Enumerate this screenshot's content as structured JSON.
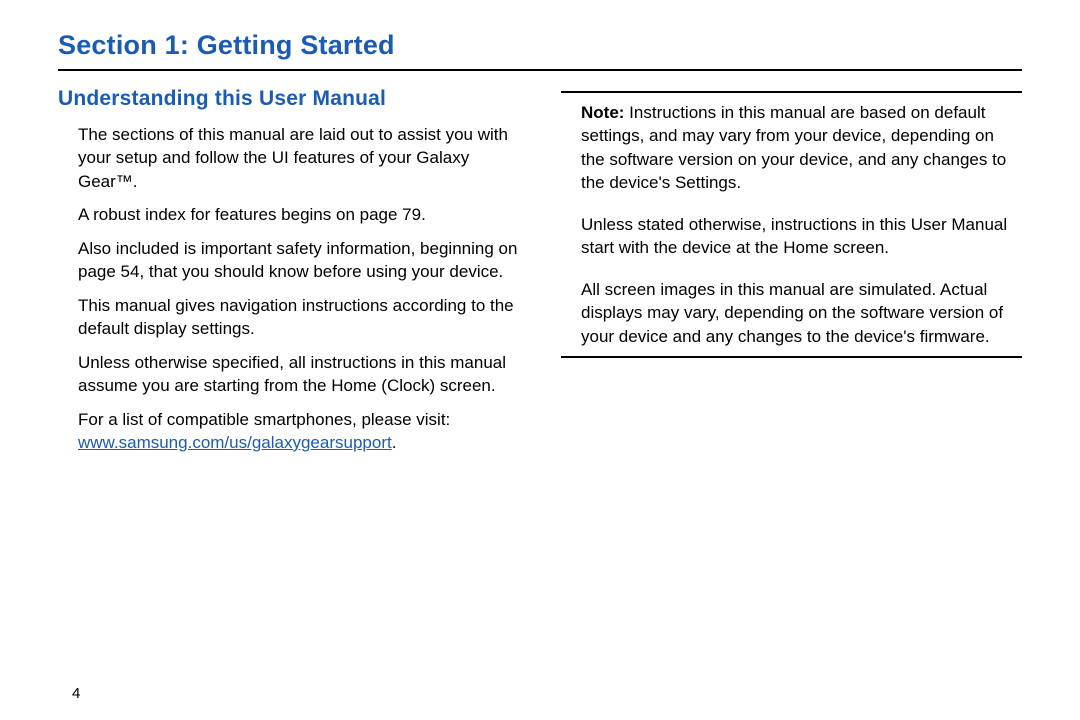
{
  "section_title": "Section 1: Getting Started",
  "sub_title": "Understanding this User Manual",
  "left": {
    "p1": "The sections of this manual are laid out to assist you with your setup and follow the UI features of your Galaxy Gear™.",
    "p2": "A robust index for features begins on page 79.",
    "p3": "Also included is important safety information, beginning on page 54, that you should know before using your device.",
    "p4": "This manual gives navigation instructions according to the default display settings.",
    "p5": "Unless otherwise specified, all instructions in this manual assume you are starting from the Home (Clock) screen.",
    "p6_a": "For a list of compatible smartphones, please visit: ",
    "link_text": "www.samsung.com/us/galaxygearsupport",
    "p6_b": "."
  },
  "right": {
    "note_label": "Note:",
    "n1_rest": " Instructions in this manual are based on default settings, and may vary from your device, depending on the software version on your device, and any changes to the device's Settings.",
    "n2": "Unless stated otherwise, instructions in this User Manual start with the device at the Home screen.",
    "n3": "All screen images in this manual are simulated. Actual displays may vary, depending on the software version of your device and any changes to the device's firmware."
  },
  "page_number": "4"
}
